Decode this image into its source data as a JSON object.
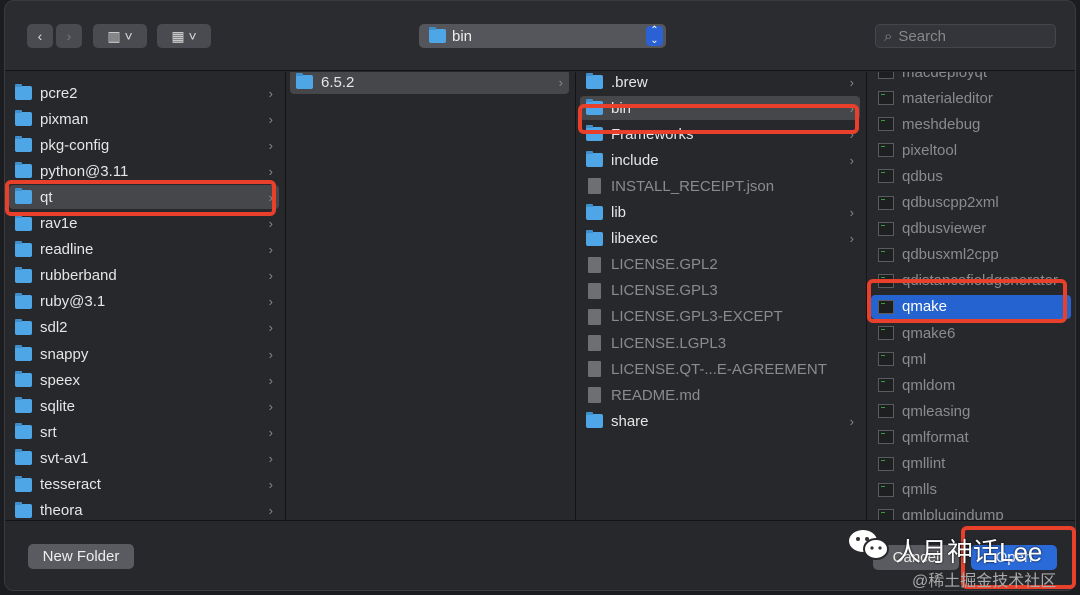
{
  "toolbar": {
    "path_label": "bin",
    "search_placeholder": "Search",
    "back": "‹",
    "forward": "›",
    "view_icon": "columns-view-icon",
    "group_icon": "group-icon"
  },
  "columns": [
    {
      "items": [
        {
          "label": "pcre2",
          "type": "folder"
        },
        {
          "label": "pixman",
          "type": "folder"
        },
        {
          "label": "pkg-config",
          "type": "folder"
        },
        {
          "label": "python@3.11",
          "type": "folder"
        },
        {
          "label": "qt",
          "type": "folder",
          "selected": true
        },
        {
          "label": "rav1e",
          "type": "folder"
        },
        {
          "label": "readline",
          "type": "folder"
        },
        {
          "label": "rubberband",
          "type": "folder"
        },
        {
          "label": "ruby@3.1",
          "type": "folder"
        },
        {
          "label": "sdl2",
          "type": "folder"
        },
        {
          "label": "snappy",
          "type": "folder"
        },
        {
          "label": "speex",
          "type": "folder"
        },
        {
          "label": "sqlite",
          "type": "folder"
        },
        {
          "label": "srt",
          "type": "folder"
        },
        {
          "label": "svt-av1",
          "type": "folder"
        },
        {
          "label": "tesseract",
          "type": "folder"
        },
        {
          "label": "theora",
          "type": "folder"
        }
      ]
    },
    {
      "items": [
        {
          "label": "6.5.2",
          "type": "folder",
          "selected": true
        }
      ]
    },
    {
      "items": [
        {
          "label": ".brew",
          "type": "folder"
        },
        {
          "label": "bin",
          "type": "folder",
          "selected": true
        },
        {
          "label": "Frameworks",
          "type": "folder"
        },
        {
          "label": "include",
          "type": "folder"
        },
        {
          "label": "INSTALL_RECEIPT.json",
          "type": "file"
        },
        {
          "label": "lib",
          "type": "folder"
        },
        {
          "label": "libexec",
          "type": "folder"
        },
        {
          "label": "LICENSE.GPL2",
          "type": "file"
        },
        {
          "label": "LICENSE.GPL3",
          "type": "file"
        },
        {
          "label": "LICENSE.GPL3-EXCEPT",
          "type": "file"
        },
        {
          "label": "LICENSE.LGPL3",
          "type": "file"
        },
        {
          "label": "LICENSE.QT-...E-AGREEMENT",
          "type": "file"
        },
        {
          "label": "README.md",
          "type": "file"
        },
        {
          "label": "share",
          "type": "folder"
        }
      ]
    },
    {
      "items": [
        {
          "label": "macdeployqt",
          "type": "exec"
        },
        {
          "label": "materialeditor",
          "type": "exec"
        },
        {
          "label": "meshdebug",
          "type": "exec"
        },
        {
          "label": "pixeltool",
          "type": "exec"
        },
        {
          "label": "qdbus",
          "type": "exec"
        },
        {
          "label": "qdbuscpp2xml",
          "type": "exec"
        },
        {
          "label": "qdbusviewer",
          "type": "exec"
        },
        {
          "label": "qdbusxml2cpp",
          "type": "exec"
        },
        {
          "label": "qdistancefieldgenerator",
          "type": "exec"
        },
        {
          "label": "qmake",
          "type": "exec",
          "active": true
        },
        {
          "label": "qmake6",
          "type": "exec"
        },
        {
          "label": "qml",
          "type": "exec"
        },
        {
          "label": "qmldom",
          "type": "exec"
        },
        {
          "label": "qmleasing",
          "type": "exec"
        },
        {
          "label": "qmlformat",
          "type": "exec"
        },
        {
          "label": "qmllint",
          "type": "exec"
        },
        {
          "label": "qmlls",
          "type": "exec"
        },
        {
          "label": "qmlplugindump",
          "type": "exec"
        }
      ]
    }
  ],
  "footer": {
    "new_folder": "New Folder",
    "cancel": "Cancel",
    "open": "Open"
  },
  "watermark": {
    "name": "人月神话Lee",
    "site": "@稀土掘金技术社区"
  },
  "colors": {
    "accent": "#2563d0",
    "annotation": "#e8402a"
  }
}
